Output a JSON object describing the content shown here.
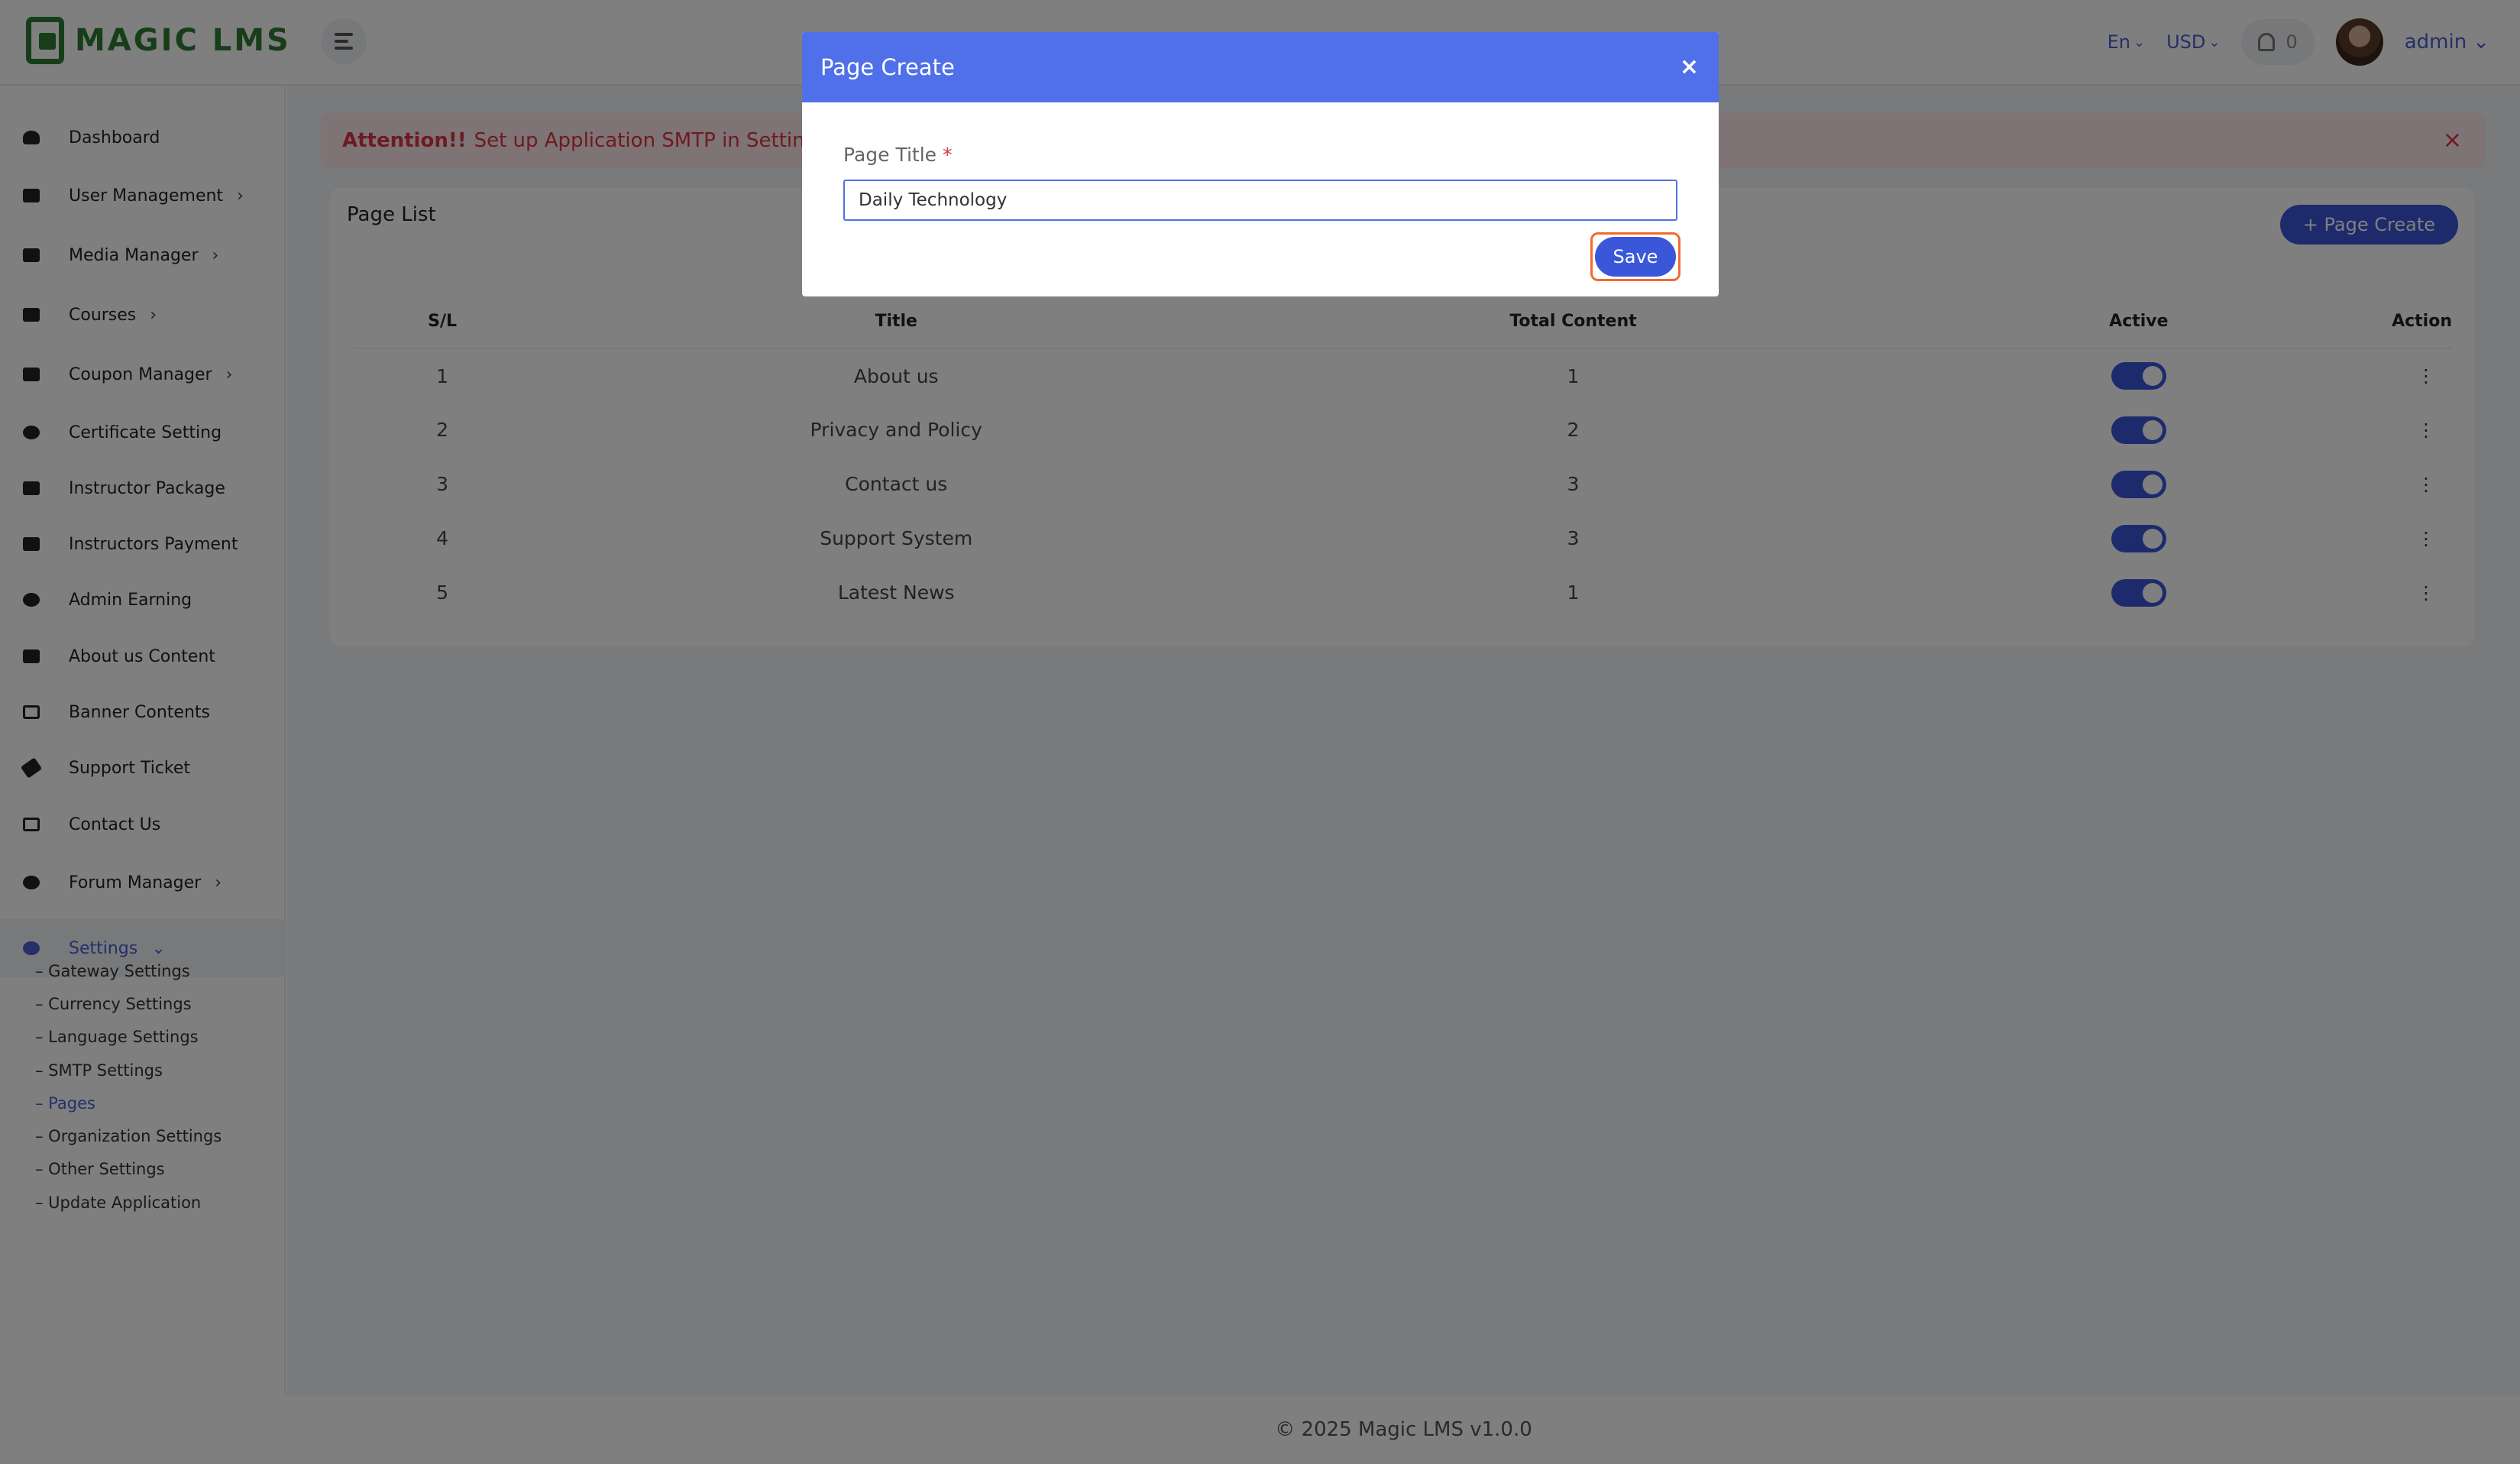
{
  "brand": {
    "logo_text": "MAGIC LMS"
  },
  "header": {
    "language": "En",
    "currency": "USD",
    "notifications_count": "0",
    "user_name": "admin"
  },
  "sidebar": {
    "items": [
      {
        "label": "Dashboard",
        "icon": "dashboard-icon",
        "has_arrow": false
      },
      {
        "label": "User Management",
        "icon": "users-icon",
        "has_arrow": true
      },
      {
        "label": "Media Manager",
        "icon": "image-icon",
        "has_arrow": true
      },
      {
        "label": "Courses",
        "icon": "book-icon",
        "has_arrow": true
      },
      {
        "label": "Coupon Manager",
        "icon": "megaphone-icon",
        "has_arrow": true
      },
      {
        "label": "Certificate Setting",
        "icon": "certificate-icon",
        "has_arrow": false
      },
      {
        "label": "Instructor Package",
        "icon": "briefcase-icon",
        "has_arrow": false
      },
      {
        "label": "Instructors Payment",
        "icon": "money-icon",
        "has_arrow": false
      },
      {
        "label": "Admin Earning",
        "icon": "history-icon",
        "has_arrow": false
      },
      {
        "label": "About us Content",
        "icon": "content-icon",
        "has_arrow": false
      },
      {
        "label": "Banner Contents",
        "icon": "note-icon",
        "has_arrow": false
      },
      {
        "label": "Support Ticket",
        "icon": "ticket-icon",
        "has_arrow": false
      },
      {
        "label": "Contact Us",
        "icon": "envelope-icon",
        "has_arrow": false
      },
      {
        "label": "Forum Manager",
        "icon": "question-icon",
        "has_arrow": true
      },
      {
        "label": "Settings",
        "icon": "gear-icon",
        "has_arrow": true
      }
    ],
    "settings_sub": [
      {
        "label": "– Gateway Settings"
      },
      {
        "label": "– Currency Settings"
      },
      {
        "label": "– Language Settings"
      },
      {
        "label": "– SMTP Settings"
      },
      {
        "label": "– Pages"
      },
      {
        "label": "– Organization Settings"
      },
      {
        "label": "– Other Settings"
      },
      {
        "label": "– Update Application"
      }
    ]
  },
  "alert": {
    "strong": "Attention!!",
    "message": "Set up Application SMTP in Settings fo"
  },
  "page_list": {
    "title": "Page List",
    "create_button": "+ Page Create",
    "columns": [
      "S/L",
      "Title",
      "Total Content",
      "Active",
      "Action"
    ],
    "rows": [
      {
        "sl": "1",
        "title": "About us",
        "total": "1",
        "active": true
      },
      {
        "sl": "2",
        "title": "Privacy and Policy",
        "total": "2",
        "active": true
      },
      {
        "sl": "3",
        "title": "Contact us",
        "total": "3",
        "active": true
      },
      {
        "sl": "4",
        "title": "Support System",
        "total": "3",
        "active": true
      },
      {
        "sl": "5",
        "title": "Latest News",
        "total": "1",
        "active": true
      }
    ]
  },
  "footer": {
    "text": "© 2025 Magic LMS v1.0.0"
  },
  "modal": {
    "title": "Page Create",
    "close": "×",
    "field_label": "Page Title",
    "required_mark": "*",
    "field_value": "Daily Technology",
    "save_label": "Save"
  },
  "colors": {
    "accent": "#3b57d9",
    "modal_header": "#4f70e8",
    "brand_green": "#2e7d32",
    "alert_red": "#dc3545",
    "highlight": "#f26a2f"
  }
}
